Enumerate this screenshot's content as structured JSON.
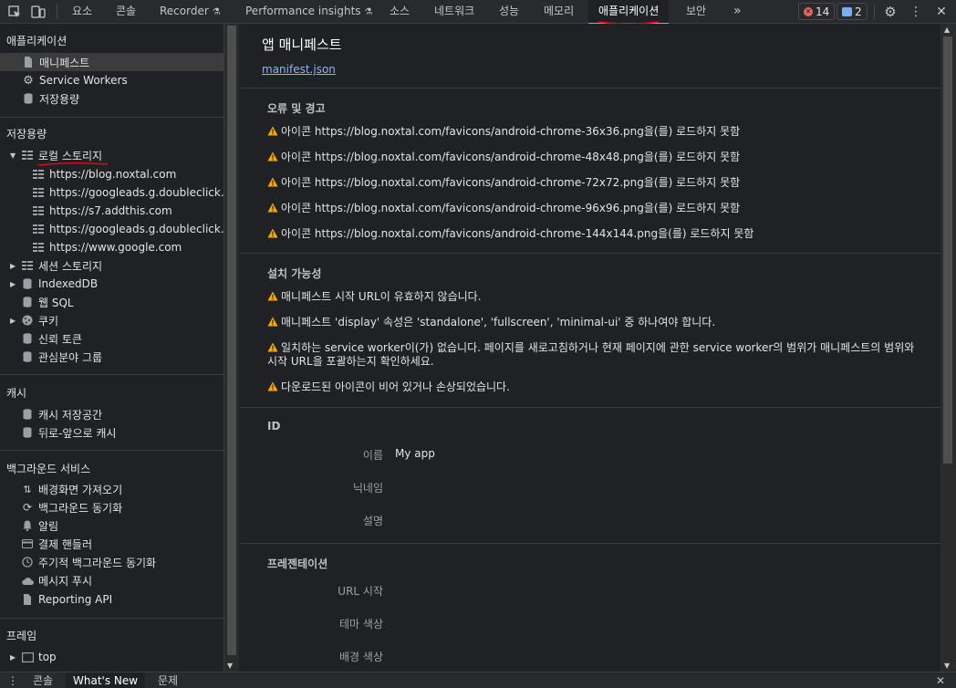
{
  "toolbar": {
    "inspect_icon": "inspect-element-icon",
    "device_icon": "device-toolbar-icon",
    "tabs": [
      {
        "label": "요소"
      },
      {
        "label": "콘솔"
      },
      {
        "label": "Recorder"
      },
      {
        "label": "Performance insights"
      },
      {
        "label": "소스"
      },
      {
        "label": "네트워크"
      },
      {
        "label": "성능"
      },
      {
        "label": "메모리"
      },
      {
        "label": "애플리케이션"
      },
      {
        "label": "보안"
      }
    ],
    "more_tabs": "»",
    "errors_count": "14",
    "issues_count": "2",
    "active_tab": "애플리케이션"
  },
  "sidebar": {
    "app_header": "애플리케이션",
    "app_items": [
      "매니페스트",
      "Service Workers",
      "저장용량"
    ],
    "storage_header": "저장용량",
    "local_storage": "로컬 스토리지",
    "local_origins": [
      "https://blog.noxtal.com",
      "https://googleads.g.doubleclick.net",
      "https://s7.addthis.com",
      "https://googleads.g.doubleclick.net",
      "https://www.google.com"
    ],
    "storage_items": [
      "세션 스토리지",
      "IndexedDB",
      "웹 SQL",
      "쿠키",
      "신뢰 토큰",
      "관심분야 그룹"
    ],
    "cache_header": "캐시",
    "cache_items": [
      "캐시 저장공간",
      "뒤로-앞으로 캐시"
    ],
    "bg_header": "백그라운드 서비스",
    "bg_items": [
      "배경화면 가져오기",
      "백그라운드 동기화",
      "알림",
      "결제 핸들러",
      "주기적 백그라운드 동기화",
      "메시지 푸시",
      "Reporting API"
    ],
    "frames_header": "프레임",
    "frame_top": "top"
  },
  "main": {
    "title": "앱 매니페스트",
    "manifest_link": "manifest.json",
    "errors_section": "오류 및 경고",
    "errors": [
      "아이콘 https://blog.noxtal.com/favicons/android-chrome-36x36.png을(를) 로드하지 못함",
      "아이콘 https://blog.noxtal.com/favicons/android-chrome-48x48.png을(를) 로드하지 못함",
      "아이콘 https://blog.noxtal.com/favicons/android-chrome-72x72.png을(를) 로드하지 못함",
      "아이콘 https://blog.noxtal.com/favicons/android-chrome-96x96.png을(를) 로드하지 못함",
      "아이콘 https://blog.noxtal.com/favicons/android-chrome-144x144.png을(를) 로드하지 못함"
    ],
    "install_section": "설치 가능성",
    "install": [
      "매니페스트 시작 URL이 유효하지 않습니다.",
      "매니페스트 'display' 속성은 'standalone', 'fullscreen', 'minimal-ui' 중 하나여야 합니다.",
      "일치하는 service worker이(가) 없습니다. 페이지를 새로고침하거나 현재 페이지에 관한 service worker의 범위가 매니페스트의 범위와 시작 URL을 포괄하는지 확인하세요.",
      "다운로드된 아이콘이 비어 있거나 손상되었습니다."
    ],
    "id_section": "ID",
    "identity_fields": [
      {
        "label": "이름",
        "value": "My app"
      },
      {
        "label": "닉네임",
        "value": ""
      },
      {
        "label": "설명",
        "value": ""
      }
    ],
    "presentation_section": "프레젠테이션",
    "presentation_fields": [
      {
        "label": "URL 시작",
        "value": ""
      },
      {
        "label": "테마 색상",
        "value": ""
      },
      {
        "label": "배경 색상",
        "value": ""
      }
    ]
  },
  "drawer": {
    "tabs": [
      "콘솔",
      "What's New",
      "문제"
    ],
    "active_tab": "What's New",
    "close": "✕"
  },
  "colors": {
    "accent": "#7cacf8",
    "link": "#8ab4f8",
    "warning": "#f9ab00",
    "error": "#e46962",
    "annotation": "#e8001c"
  }
}
